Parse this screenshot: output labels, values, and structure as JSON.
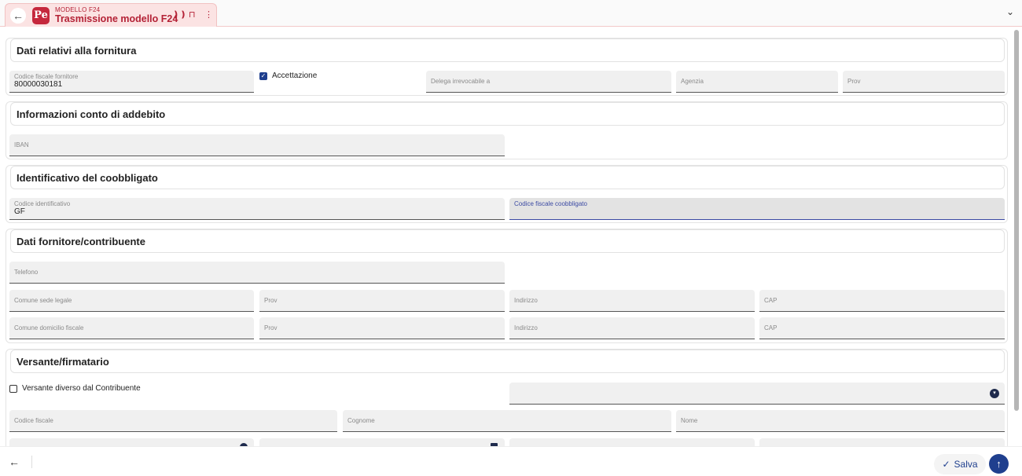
{
  "header": {
    "back_icon": "arrow-left-icon",
    "logo_text": "Pe",
    "pretitle": "MODELLO F24",
    "title": "Trasmissione modello F24",
    "icons": [
      "split-icon",
      "bookmark-icon",
      "more-vert-icon"
    ],
    "expand_icon": "chevron-down-icon"
  },
  "sections": {
    "fornitura": {
      "title": "Dati relativi alla fornitura",
      "codice_fiscale_fornitore": {
        "label": "Codice fiscale fornitore",
        "value": "80000030181"
      },
      "accettazione": {
        "label": "Accettazione",
        "checked": true
      },
      "delega_irrevocabile": {
        "label": "Delega irrevocabile a"
      },
      "agenzia": {
        "label": "Agenzia"
      },
      "prov": {
        "label": "Prov"
      }
    },
    "conto": {
      "title": "Informazioni conto di addebito",
      "iban": {
        "label": "IBAN"
      }
    },
    "coobbligato": {
      "title": "Identificativo del coobbligato",
      "codice_identificativo": {
        "label": "Codice identificativo",
        "value": "GF"
      },
      "codice_fiscale_coobbligato": {
        "label": "Codice fiscale coobbligato"
      }
    },
    "fornitore_contribuente": {
      "title": "Dati fornitore/contribuente",
      "telefono": {
        "label": "Telefono"
      },
      "comune_sede_legale": {
        "label": "Comune sede legale"
      },
      "prov1": {
        "label": "Prov"
      },
      "indirizzo1": {
        "label": "Indirizzo"
      },
      "cap1": {
        "label": "CAP"
      },
      "comune_domicilio": {
        "label": "Comune domicilio fiscale"
      },
      "prov2": {
        "label": "Prov"
      },
      "indirizzo2": {
        "label": "Indirizzo"
      },
      "cap2": {
        "label": "CAP"
      }
    },
    "versante": {
      "title": "Versante/firmatario",
      "versante_diverso": {
        "label": "Versante diverso dal Contribuente",
        "checked": false
      },
      "select_icon": "dropdown-circle-icon",
      "codice_fiscale": {
        "label": "Codice fiscale"
      },
      "cognome": {
        "label": "Cognome"
      },
      "nome": {
        "label": "Nome"
      }
    }
  },
  "footer": {
    "back_icon": "arrow-left-icon",
    "save_label": "Salva",
    "save_icon": "check-icon",
    "scroll_top_icon": "arrow-up-icon"
  },
  "colors": {
    "accent": "#1f3f8e",
    "brand": "#c5283d",
    "tab_bg": "#fbe3e3"
  }
}
